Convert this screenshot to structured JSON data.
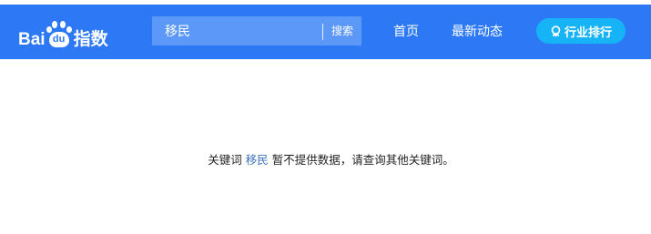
{
  "logo": {
    "text_bai": "Bai",
    "text_du": "du",
    "text_zhishu": "指数"
  },
  "search": {
    "value": "移民",
    "button_label": "搜索"
  },
  "nav": {
    "home": "首页",
    "news": "最新动态"
  },
  "rank_button": {
    "label": "行业排行",
    "icon": "trophy-icon"
  },
  "message": {
    "prefix": "关键词",
    "keyword": "移民",
    "suffix": "暂不提供数据，请查询其他关键词。"
  },
  "colors": {
    "topbar": "#2d79f5",
    "search_bg": "#5b98f7",
    "rank_bg": "#16b3f6",
    "keyword": "#3d73b8"
  }
}
